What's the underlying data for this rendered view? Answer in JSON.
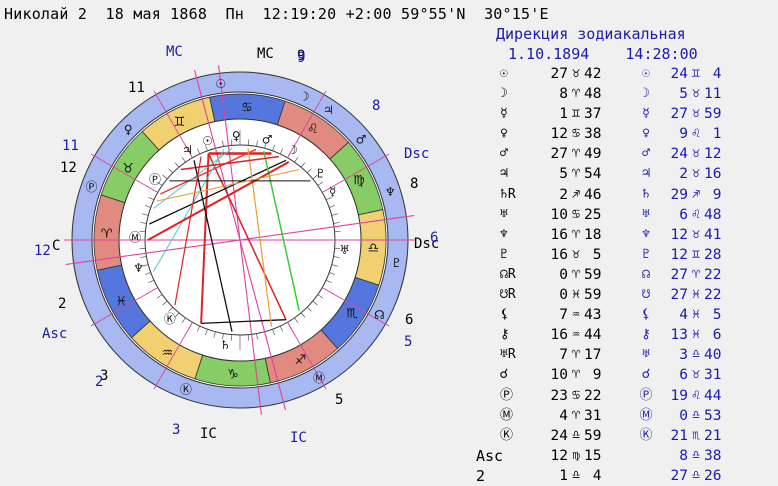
{
  "header": {
    "name": "Николай 2",
    "date": "18 мая 1868",
    "weekday": "Пн",
    "time": "12:19:20",
    "tz": "+2:00",
    "lat": "59°55'N",
    "lon": "30°15'E"
  },
  "direction": {
    "title": "Дирекция зодиакальная",
    "date": "1.10.1894",
    "time": "14:28:00"
  },
  "wheel_labels": {
    "mc_natal": "MC",
    "mc_dir": "MC",
    "dsc_dir": "Dsc",
    "dsc_natal": "Dsc",
    "asc_dir": "Asc",
    "ic_natal": "IC",
    "ic_dir": "IC",
    "c_label": "C",
    "house_natal": [
      "11",
      "12",
      "2",
      "3",
      "5",
      "6",
      "8",
      "9"
    ],
    "house_dir": [
      "9",
      "8",
      "6",
      "5",
      "3",
      "2",
      "12",
      "11"
    ]
  },
  "natal_positions": [
    {
      "sym": "☉",
      "deg": "27",
      "sign": "♉",
      "min": "42"
    },
    {
      "sym": "☽",
      "deg": "8",
      "sign": "♈",
      "min": "48"
    },
    {
      "sym": "☿",
      "deg": "1",
      "sign": "♊",
      "min": "37"
    },
    {
      "sym": "♀",
      "deg": "12",
      "sign": "♋",
      "min": "38"
    },
    {
      "sym": "♂",
      "deg": "27",
      "sign": "♈",
      "min": "49"
    },
    {
      "sym": "♃",
      "deg": "5",
      "sign": "♈",
      "min": "54"
    },
    {
      "sym": "♄R",
      "deg": "2",
      "sign": "♐",
      "min": "46"
    },
    {
      "sym": "♅",
      "deg": "10",
      "sign": "♋",
      "min": "25"
    },
    {
      "sym": "♆",
      "deg": "16",
      "sign": "♈",
      "min": "18"
    },
    {
      "sym": "♇",
      "deg": "16",
      "sign": "♉",
      "min": " 5"
    },
    {
      "sym": "☊R",
      "deg": "0",
      "sign": "♈",
      "min": "59"
    },
    {
      "sym": "☋R",
      "deg": "0",
      "sign": "♓",
      "min": "59"
    },
    {
      "sym": "⚸",
      "deg": "7",
      "sign": "♒",
      "min": "43"
    },
    {
      "sym": "⚷",
      "deg": "16",
      "sign": "♒",
      "min": "44"
    },
    {
      "sym": "♅R",
      "deg": "7",
      "sign": "♈",
      "min": "17"
    },
    {
      "sym": "☌",
      "deg": "10",
      "sign": "♈",
      "min": " 9"
    },
    {
      "sym": "Ⓟ",
      "deg": "23",
      "sign": "♋",
      "min": "22"
    },
    {
      "sym": "Ⓜ",
      "deg": "4",
      "sign": "♈",
      "min": "31"
    },
    {
      "sym": "Ⓚ",
      "deg": "24",
      "sign": "♎",
      "min": "59"
    },
    {
      "sym": "Asc",
      "deg": "12",
      "sign": "♍",
      "min": "15"
    },
    {
      "sym": "2",
      "deg": "1",
      "sign": "♎",
      "min": " 4"
    }
  ],
  "dir_positions": [
    {
      "sym": "☉",
      "deg": "24",
      "sign": "♊",
      "min": " 4"
    },
    {
      "sym": "☽",
      "deg": "5",
      "sign": "♉",
      "min": "11"
    },
    {
      "sym": "☿",
      "deg": "27",
      "sign": "♉",
      "min": "59"
    },
    {
      "sym": "♀",
      "deg": "9",
      "sign": "♌",
      "min": " 1"
    },
    {
      "sym": "♂",
      "deg": "24",
      "sign": "♉",
      "min": "12"
    },
    {
      "sym": "♃",
      "deg": "2",
      "sign": "♉",
      "min": "16"
    },
    {
      "sym": "♄",
      "deg": "29",
      "sign": "♐",
      "min": " 9"
    },
    {
      "sym": "♅",
      "deg": "6",
      "sign": "♌",
      "min": "48"
    },
    {
      "sym": "♆",
      "deg": "12",
      "sign": "♉",
      "min": "41"
    },
    {
      "sym": "♇",
      "deg": "12",
      "sign": "♊",
      "min": "28"
    },
    {
      "sym": "☊",
      "deg": "27",
      "sign": "♈",
      "min": "22"
    },
    {
      "sym": "☋",
      "deg": "27",
      "sign": "♓",
      "min": "22"
    },
    {
      "sym": "⚸",
      "deg": "4",
      "sign": "♓",
      "min": " 5"
    },
    {
      "sym": "⚷",
      "deg": "13",
      "sign": "♓",
      "min": " 6"
    },
    {
      "sym": "♅",
      "deg": "3",
      "sign": "♎",
      "min": "40"
    },
    {
      "sym": "☌",
      "deg": "6",
      "sign": "♉",
      "min": "31"
    },
    {
      "sym": "Ⓟ",
      "deg": "19",
      "sign": "♌",
      "min": "44"
    },
    {
      "sym": "Ⓜ",
      "deg": "0",
      "sign": "♎",
      "min": "53"
    },
    {
      "sym": "Ⓚ",
      "deg": "21",
      "sign": "♏",
      "min": "21"
    },
    {
      "sym": "",
      "deg": "8",
      "sign": "♎",
      "min": "38"
    },
    {
      "sym": "",
      "deg": "27",
      "sign": "♎",
      "min": "26"
    }
  ],
  "colors": {
    "dir_text": "#1a1ab0",
    "fire": "#e08a80",
    "earth": "#88cc66",
    "air": "#f0d070",
    "water": "#5577dd",
    "ring": "#a8b8f0",
    "axis": "#e040a0"
  },
  "zodiac_glyphs": [
    "♈",
    "♉",
    "♊",
    "♋",
    "♌",
    "♍",
    "♎",
    "♏",
    "♐",
    "♑",
    "♒",
    "♓"
  ]
}
